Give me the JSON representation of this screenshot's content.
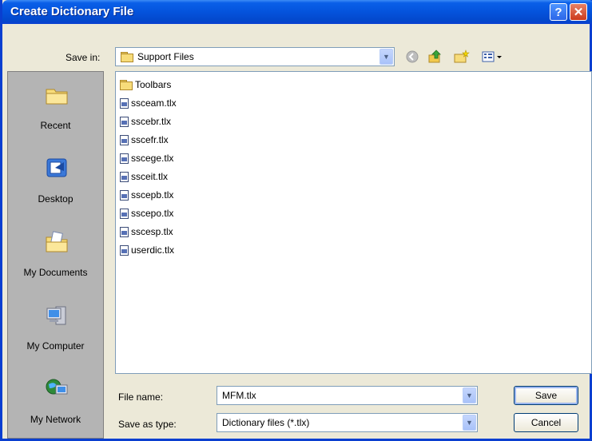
{
  "window": {
    "title": "Create Dictionary File"
  },
  "toolbar": {
    "save_in_label": "Save in:",
    "save_in_value": "Support Files",
    "icons": [
      "back-icon",
      "up-folder-icon",
      "new-folder-icon",
      "view-menu-icon"
    ]
  },
  "places": [
    {
      "label": "Recent",
      "icon": "recent-icon"
    },
    {
      "label": "Desktop",
      "icon": "desktop-icon"
    },
    {
      "label": "My Documents",
      "icon": "my-documents-icon"
    },
    {
      "label": "My Computer",
      "icon": "my-computer-icon"
    },
    {
      "label": "My Network",
      "icon": "my-network-icon"
    }
  ],
  "files": [
    {
      "name": "Toolbars",
      "type": "folder"
    },
    {
      "name": "ssceam.tlx",
      "type": "file"
    },
    {
      "name": "sscebr.tlx",
      "type": "file"
    },
    {
      "name": "sscefr.tlx",
      "type": "file"
    },
    {
      "name": "sscege.tlx",
      "type": "file"
    },
    {
      "name": "ssceit.tlx",
      "type": "file"
    },
    {
      "name": "sscepb.tlx",
      "type": "file"
    },
    {
      "name": "sscepo.tlx",
      "type": "file"
    },
    {
      "name": "sscesp.tlx",
      "type": "file"
    },
    {
      "name": "userdic.tlx",
      "type": "file"
    }
  ],
  "form": {
    "file_name_label": "File name:",
    "file_name_value": "MFM.tlx",
    "save_as_type_label": "Save as type:",
    "save_as_type_value": "Dictionary files (*.tlx)"
  },
  "buttons": {
    "save": "Save",
    "cancel": "Cancel"
  },
  "colors": {
    "titlebar": "#0453dc",
    "frame": "#0a3fd0",
    "dialog_bg": "#ece9d8",
    "places_bg": "#b4b4b4"
  }
}
